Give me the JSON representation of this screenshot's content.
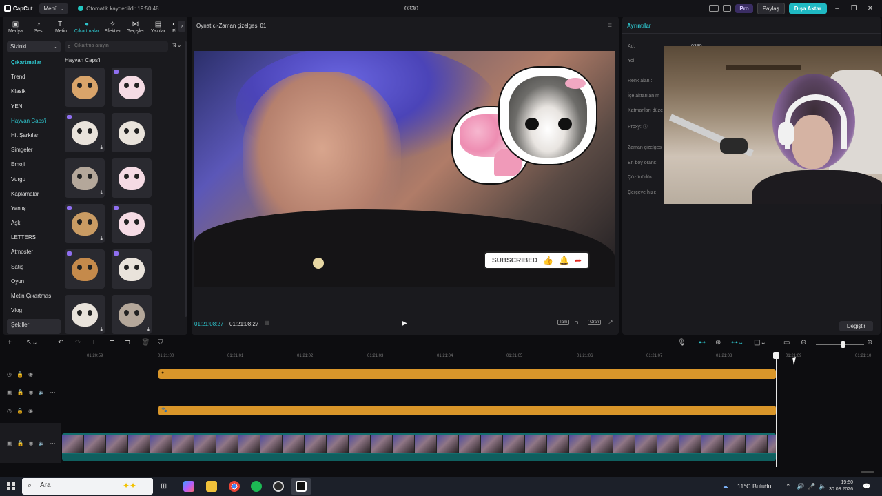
{
  "titlebar": {
    "logo": "CapCut",
    "menu": "Menü",
    "autosave": "Otomatik kaydedildi: 19:50:48",
    "project_name": "0330",
    "pro": "Pro",
    "share": "Paylaş",
    "export": "Dışa Aktar"
  },
  "tabs": [
    {
      "label": "Medya",
      "icon": "media-icon",
      "glyph": "▣"
    },
    {
      "label": "Ses",
      "icon": "audio-icon",
      "glyph": "◔"
    },
    {
      "label": "Metin",
      "icon": "text-icon",
      "glyph": "TI"
    },
    {
      "label": "Çıkartmalar",
      "icon": "sticker-icon",
      "glyph": "●"
    },
    {
      "label": "Efektler",
      "icon": "effects-icon",
      "glyph": "✧"
    },
    {
      "label": "Geçişler",
      "icon": "transition-icon",
      "glyph": "⋈"
    },
    {
      "label": "Yazılar",
      "icon": "captions-icon",
      "glyph": "▤"
    },
    {
      "label": "Fi",
      "icon": "filter-icon",
      "glyph": "◐"
    }
  ],
  "left": {
    "dropdown": "Sizinki",
    "search_placeholder": "Çıkartma arayın",
    "section_title": "Hayvan Caps'i",
    "categories": [
      "Çıkartmalar",
      "Trend",
      "Klasik",
      "YENİ",
      "Hayvan Caps'i",
      "Hit Şarkılar",
      "Simgeler",
      "Emoji",
      "Vurgu",
      "Kaplamalar",
      "Yanlış",
      "Aşk",
      "LETTERS",
      "Atmosfer",
      "Satış",
      "Oyun",
      "Metin Çıkartması",
      "Vlog",
      "Şekiller"
    ]
  },
  "player": {
    "title": "Oynatıcı-Zaman çizelgesi 01",
    "current_time": "01:21:08:27",
    "total_time": "01:21:08:27",
    "full_label": "Tam",
    "ratio_label": "Oran",
    "subscribe": "SUBSCRIBED"
  },
  "details": {
    "title": "Ayrıntılar",
    "rows": [
      {
        "label": "Ad:",
        "value": "0330"
      },
      {
        "label": "Yol:",
        "value": ""
      },
      {
        "label": "Renk alanı:",
        "value": ""
      },
      {
        "label": "İçe aktarılan m",
        "value": ""
      },
      {
        "label": "Katmanları düze",
        "value": ""
      },
      {
        "label": "Proxy:",
        "value": ""
      },
      {
        "label": "Zaman çizelges",
        "value": ""
      },
      {
        "label": "En boy oranı:",
        "value": ""
      },
      {
        "label": "Çözünürlük:",
        "value": ""
      },
      {
        "label": "Çerçeve hızı:",
        "value": ""
      }
    ],
    "change_button": "Değiştir"
  },
  "timeline": {
    "ruler": [
      "01:20:59",
      "01:21:00",
      "01:21:01",
      "01:21:02",
      "01:21:03",
      "01:21:04",
      "01:21:05",
      "01:21:06",
      "01:21:07",
      "01:21:08",
      "01:21:09",
      "01:21:10"
    ]
  },
  "taskbar": {
    "search": "Ara",
    "weather": "11°C  Bulutlu",
    "time": "19:50",
    "date": "30.03.2026"
  },
  "colors": {
    "accent": "#2ec4cc",
    "clip": "#d9962a",
    "video_track": "#136d6d"
  }
}
